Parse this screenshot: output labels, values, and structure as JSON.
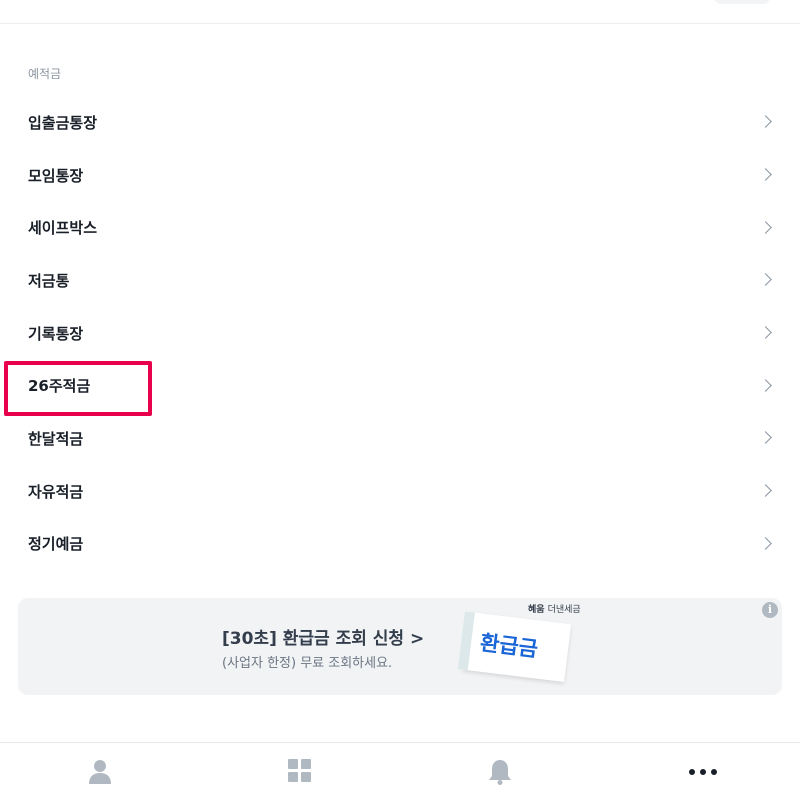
{
  "section": {
    "label": "예적금"
  },
  "menu": {
    "items": [
      {
        "label": "입출금통장"
      },
      {
        "label": "모임통장"
      },
      {
        "label": "세이프박스"
      },
      {
        "label": "저금통"
      },
      {
        "label": "기록통장"
      },
      {
        "label": "26주적금"
      },
      {
        "label": "한달적금"
      },
      {
        "label": "자유적금"
      },
      {
        "label": "정기예금"
      }
    ]
  },
  "banner": {
    "title": "[30초] 환급금 조회 신청 >",
    "subtitle": "(사업자 한정) 무료 조회하세요.",
    "brand_name": "혜움",
    "brand_product": "더낸세금",
    "ticket_text": "환급금",
    "info_icon": "info-icon"
  },
  "bottom_nav": {
    "items": [
      {
        "icon": "person-icon"
      },
      {
        "icon": "grid-icon"
      },
      {
        "icon": "bell-icon"
      },
      {
        "icon": "more-icon"
      }
    ]
  },
  "colors": {
    "highlight": "#e8004c",
    "text_primary": "#191f28",
    "text_secondary": "#8b95a1",
    "ticket_blue": "#1b66d6",
    "banner_bg": "#f2f3f5"
  }
}
